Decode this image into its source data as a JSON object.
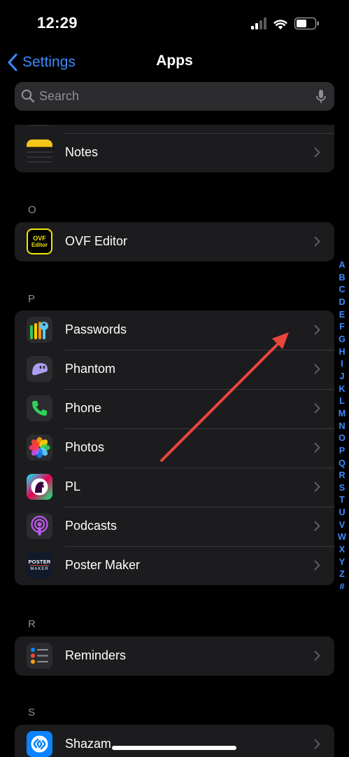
{
  "status_bar": {
    "time": "12:29"
  },
  "nav": {
    "back_label": "Settings",
    "title": "Apps"
  },
  "search": {
    "placeholder": "Search",
    "value": ""
  },
  "sections": {
    "n": {
      "items": [
        {
          "label": ""
        },
        {
          "label": "Notes"
        }
      ]
    },
    "o": {
      "letter": "O",
      "items": [
        {
          "label": "OVF Editor"
        }
      ]
    },
    "p": {
      "letter": "P",
      "items": [
        {
          "label": "Passwords"
        },
        {
          "label": "Phantom"
        },
        {
          "label": "Phone"
        },
        {
          "label": "Photos"
        },
        {
          "label": "PL"
        },
        {
          "label": "Podcasts"
        },
        {
          "label": "Poster Maker"
        }
      ]
    },
    "r": {
      "letter": "R",
      "items": [
        {
          "label": "Reminders"
        }
      ]
    },
    "s": {
      "letter": "S",
      "items": [
        {
          "label": "Shazam"
        }
      ]
    }
  },
  "icon_text": {
    "ovf_line1": "OVF",
    "ovf_line2": "Editor",
    "poster_line1": "POSTER",
    "poster_line2": "MAKER"
  },
  "index_letters": [
    "A",
    "B",
    "C",
    "D",
    "E",
    "F",
    "G",
    "H",
    "I",
    "J",
    "K",
    "L",
    "M",
    "N",
    "O",
    "P",
    "Q",
    "R",
    "S",
    "T",
    "U",
    "V",
    "W",
    "X",
    "Y",
    "Z",
    "#"
  ],
  "colors": {
    "accent": "#3c8cff",
    "annotation_arrow": "#e8453c"
  }
}
